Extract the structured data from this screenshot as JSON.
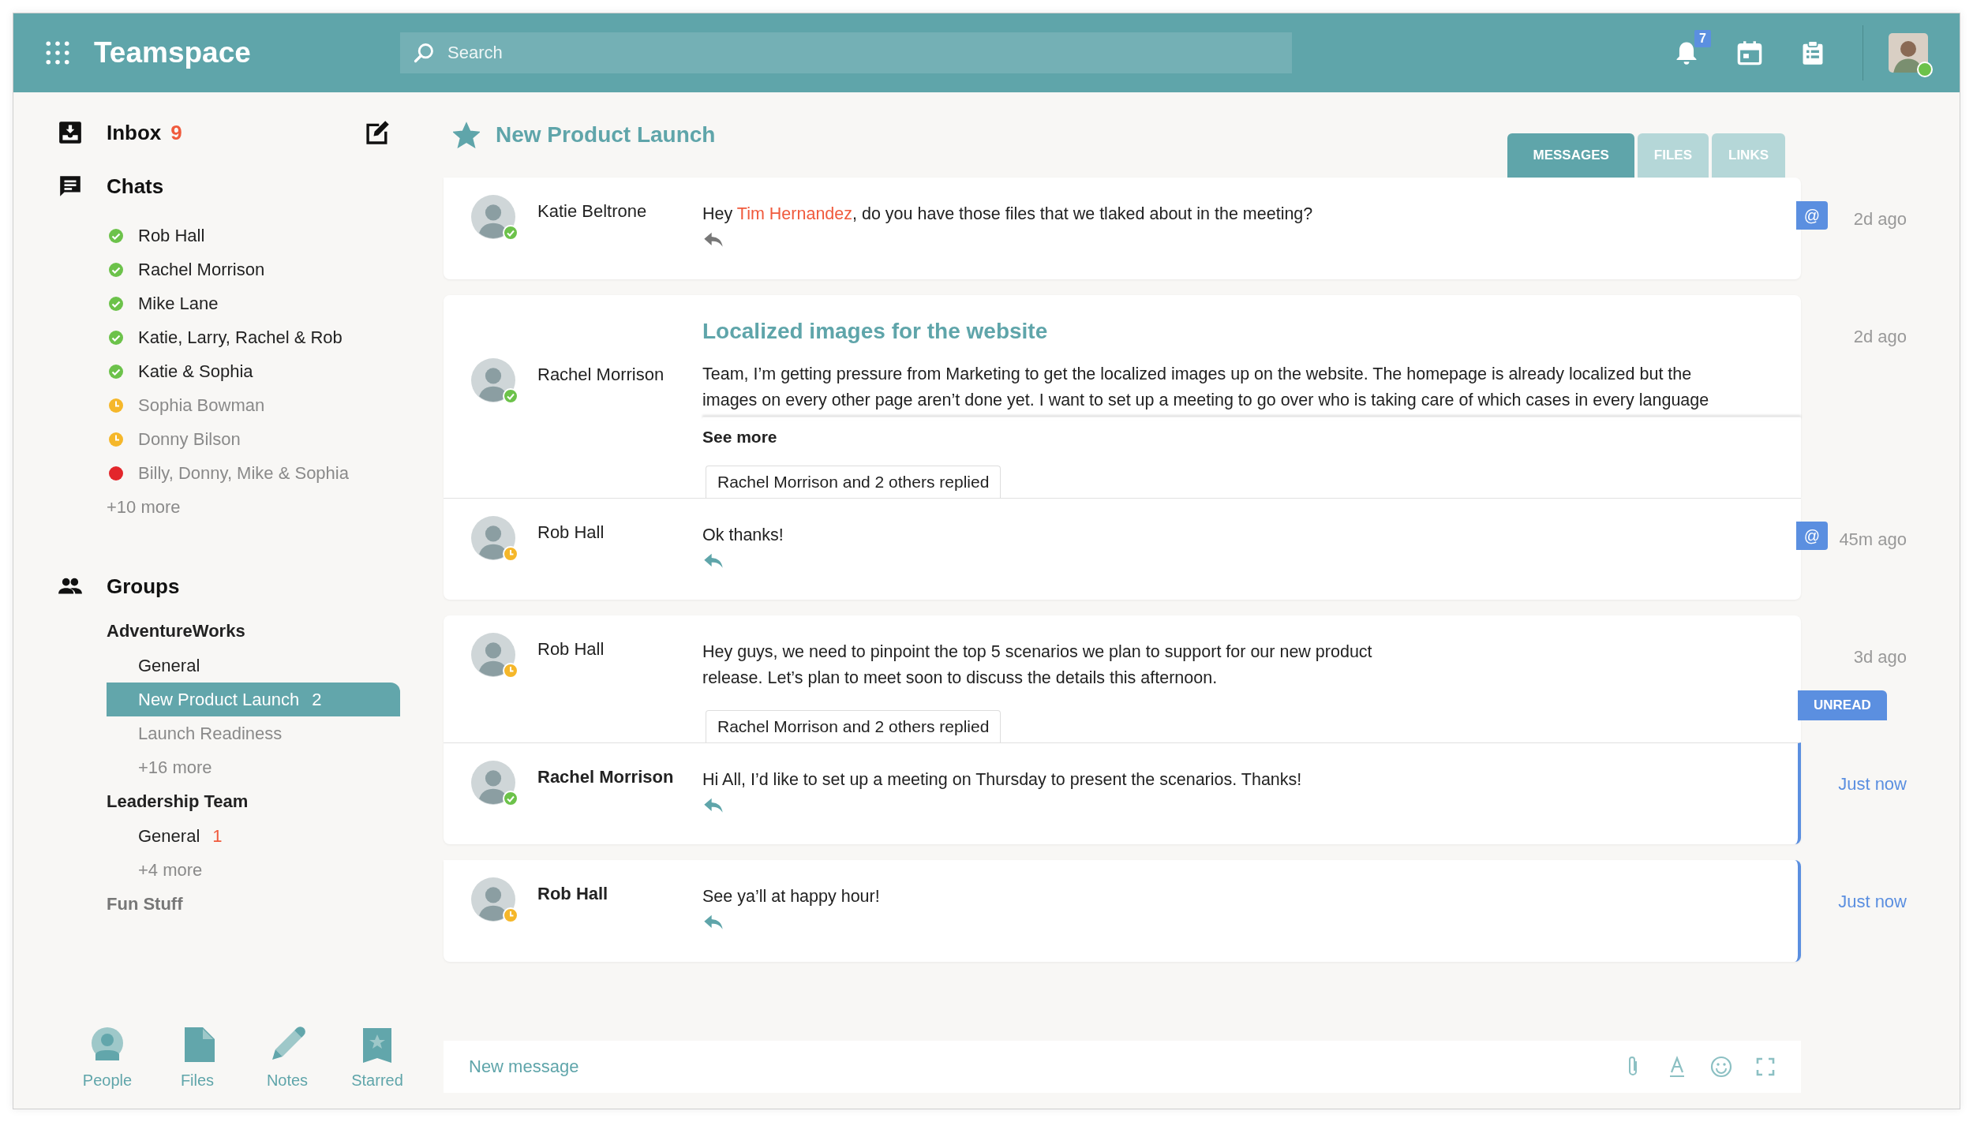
{
  "app": {
    "title": "Teamspace"
  },
  "search": {
    "placeholder": "Search"
  },
  "notifications": {
    "count": "7"
  },
  "user": {
    "color": "#6cc24a"
  },
  "sidebar": {
    "inbox": {
      "label": "Inbox",
      "count": "9"
    },
    "chats": {
      "label": "Chats",
      "items": [
        {
          "name": "Rob Hall",
          "kind": "online",
          "color": "#6cc24a"
        },
        {
          "name": "Rachel Morrison",
          "kind": "online",
          "color": "#6cc24a"
        },
        {
          "name": "Mike Lane",
          "kind": "online",
          "color": "#6cc24a"
        },
        {
          "name": "Katie, Larry, Rachel & Rob",
          "kind": "online",
          "color": "#6cc24a"
        },
        {
          "name": "Katie & Sophia",
          "kind": "online",
          "color": "#6cc24a"
        },
        {
          "name": "Sophia Bowman",
          "kind": "away",
          "color": "#f5b72a"
        },
        {
          "name": "Donny Bilson",
          "kind": "away",
          "color": "#f5b72a"
        },
        {
          "name": "Billy, Donny, Mike & Sophia",
          "kind": "busy",
          "color": "#e3262b"
        }
      ],
      "more": "+10 more"
    },
    "groups": {
      "label": "Groups",
      "teams": [
        {
          "name": "AdventureWorks",
          "channels": [
            {
              "name": "General",
              "selected": false,
              "muted": false
            },
            {
              "name": "New Product Launch",
              "count": "2",
              "selected": true,
              "muted": false
            },
            {
              "name": "Launch Readiness",
              "selected": false,
              "muted": true
            }
          ],
          "more": "+16 more"
        },
        {
          "name": "Leadership Team",
          "channels": [
            {
              "name": "General",
              "count": "1",
              "selected": false,
              "muted": false
            }
          ],
          "more": "+4 more"
        },
        {
          "name": "Fun Stuff"
        }
      ]
    }
  },
  "bottom_nav": [
    {
      "label": "People",
      "kind": "people"
    },
    {
      "label": "Files",
      "kind": "files"
    },
    {
      "label": "Notes",
      "kind": "notes"
    },
    {
      "label": "Starred",
      "kind": "starred"
    }
  ],
  "channel": {
    "title": "New Product Launch",
    "starred": true
  },
  "tabs": [
    {
      "label": "MESSAGES",
      "selected": true
    },
    {
      "label": "FILES",
      "selected": false
    },
    {
      "label": "LINKS",
      "selected": false
    }
  ],
  "threads": [
    {
      "messages": [
        {
          "author": "Katie Beltrone",
          "kind": "online",
          "color": "#6cc24a",
          "time": "2d ago",
          "badge": "@",
          "unread": false,
          "segments": [
            {
              "text": "Hey "
            },
            {
              "text": "Tim Hernandez",
              "kind": "mention"
            },
            {
              "text": ", do you have those files that we tlaked about in the meeting?"
            }
          ]
        }
      ]
    },
    {
      "messages": [
        {
          "author": "Rachel Morrison",
          "kind": "online",
          "color": "#6cc24a",
          "time": "2d ago",
          "unread": false,
          "subject": "Localized images for the website",
          "segments": [
            {
              "text": "Team, I’m getting pressure from Marketing to get the localized images up on the website. The homepage is already localized but the\nimages on every other page aren’t done yet. I want to set up a meeting to go over who is taking care of which cases in every language"
            }
          ],
          "see_more": "See more",
          "replied": "Rachel Morrison and 2 others replied"
        },
        {
          "author": "Rob Hall",
          "kind": "away",
          "color": "#f5b72a",
          "time": "45m ago",
          "badge": "@",
          "unread": false,
          "segments": [
            {
              "text": "Ok thanks!"
            }
          ]
        }
      ]
    },
    {
      "messages": [
        {
          "author": "Rob Hall",
          "kind": "away",
          "color": "#f5b72a",
          "time": "3d ago",
          "unread": false,
          "segments": [
            {
              "text": "Hey guys, we need to pinpoint the top 5 scenarios we plan to support for our new product\nrelease. Let’s plan to meet soon to discuss the details this afternoon."
            }
          ],
          "replied": "Rachel Morrison and 2 others replied"
        },
        {
          "author": "Rachel Morrison",
          "kind": "online",
          "color": "#6cc24a",
          "time": "Just now",
          "unread": true,
          "marker": "UNREAD",
          "segments": [
            {
              "text": "Hi All, I’d like to set up a meeting on Thursday to present the scenarios. Thanks!"
            }
          ]
        }
      ]
    },
    {
      "messages": [
        {
          "author": "Rob Hall",
          "kind": "away",
          "color": "#f5b72a",
          "time": "Just now",
          "unread": true,
          "segments": [
            {
              "text": "See ya’ll at happy hour!"
            }
          ]
        }
      ]
    }
  ],
  "composer": {
    "placeholder": "New message"
  }
}
